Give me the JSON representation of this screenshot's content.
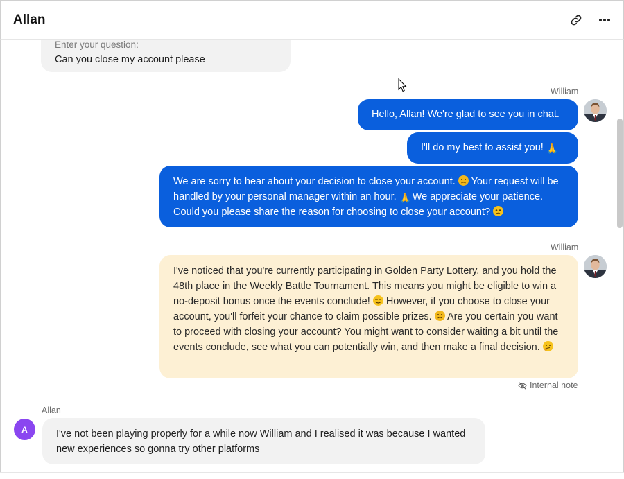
{
  "header": {
    "title": "Allan",
    "icons": [
      "link-icon",
      "more-icon"
    ]
  },
  "messages": [
    {
      "type": "incoming",
      "sender": "Allan",
      "label": "Enter your question:",
      "text": "Can you close my account please"
    },
    {
      "type": "outgoing",
      "sender": "William",
      "text": "Hello, Allan! We're glad to see you in chat."
    },
    {
      "type": "outgoing",
      "text_before": "I'll do my best to assist you!",
      "emoji": "pray"
    },
    {
      "type": "outgoing",
      "lines": [
        "We are sorry to hear about your decision to close your account.",
        "Your request will be handled by your personal manager within an hour.",
        "We appreciate your patience. Could you please share the reason for choosing to close your account?"
      ]
    },
    {
      "type": "internal-note",
      "sender": "William",
      "parts": [
        "I've noticed that you're currently participating in Golden Party Lottery, and you hold the 48th place in the Weekly Battle Tournament. This means you might be eligible to win a no-deposit bonus once the events conclude!",
        "However, if you choose to close your account, you'll forfeit your chance to claim possible prizes.",
        "Are you certain you want to proceed with closing your account? You might want to consider waiting a bit until the events conclude, see what you can potentially win, and then make a final decision."
      ],
      "note_label": "Internal note"
    },
    {
      "type": "incoming",
      "sender": "Allan",
      "avatar_letter": "A",
      "text": "I've not been playing properly for a while now William and I realised it was because I wanted new experiences so gonna try other platforms"
    }
  ],
  "colors": {
    "outgoing": "#0a5fdd",
    "incoming": "#f2f2f2",
    "note": "#fdf0d4",
    "avatar_letter_bg": "#8a46f0"
  }
}
